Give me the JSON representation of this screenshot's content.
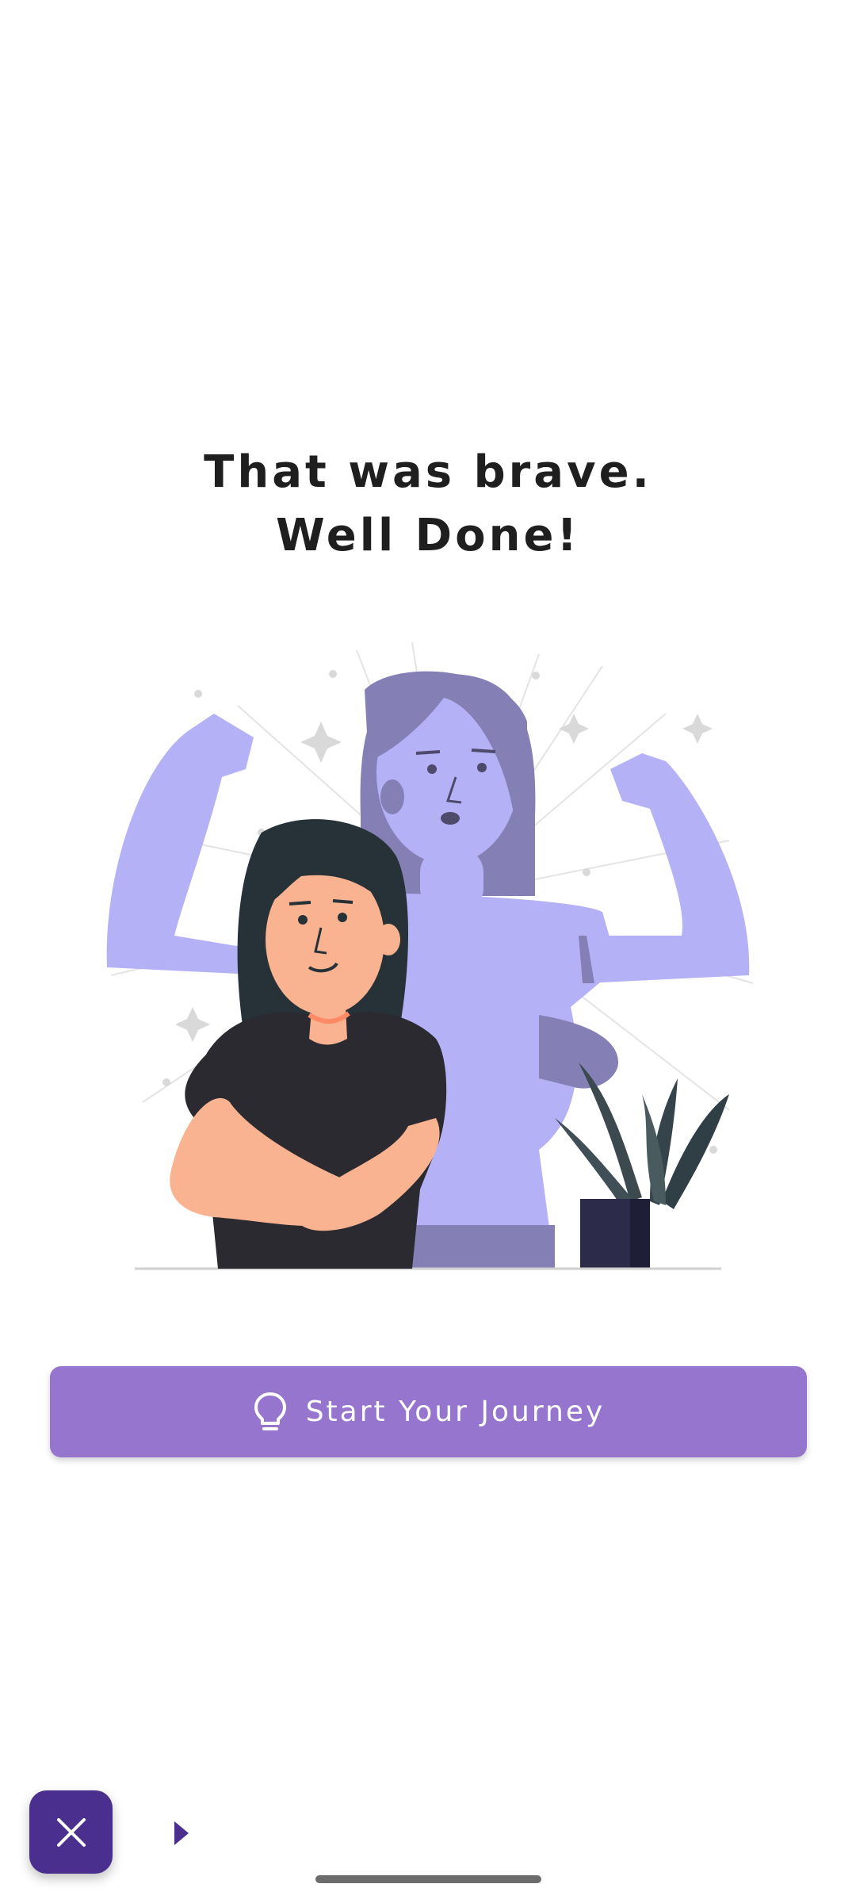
{
  "headline": {
    "line1": "That was brave.",
    "line2": "Well Done!"
  },
  "illustration": {
    "name": "celebration-illustration"
  },
  "cta": {
    "label": "Start Your Journey",
    "icon": "lightbulb-icon",
    "color": "#9575cd"
  },
  "bottom_controls": {
    "close_icon": "close-icon",
    "close_color": "#4a2f8f",
    "play_icon": "play-arrow-icon"
  }
}
